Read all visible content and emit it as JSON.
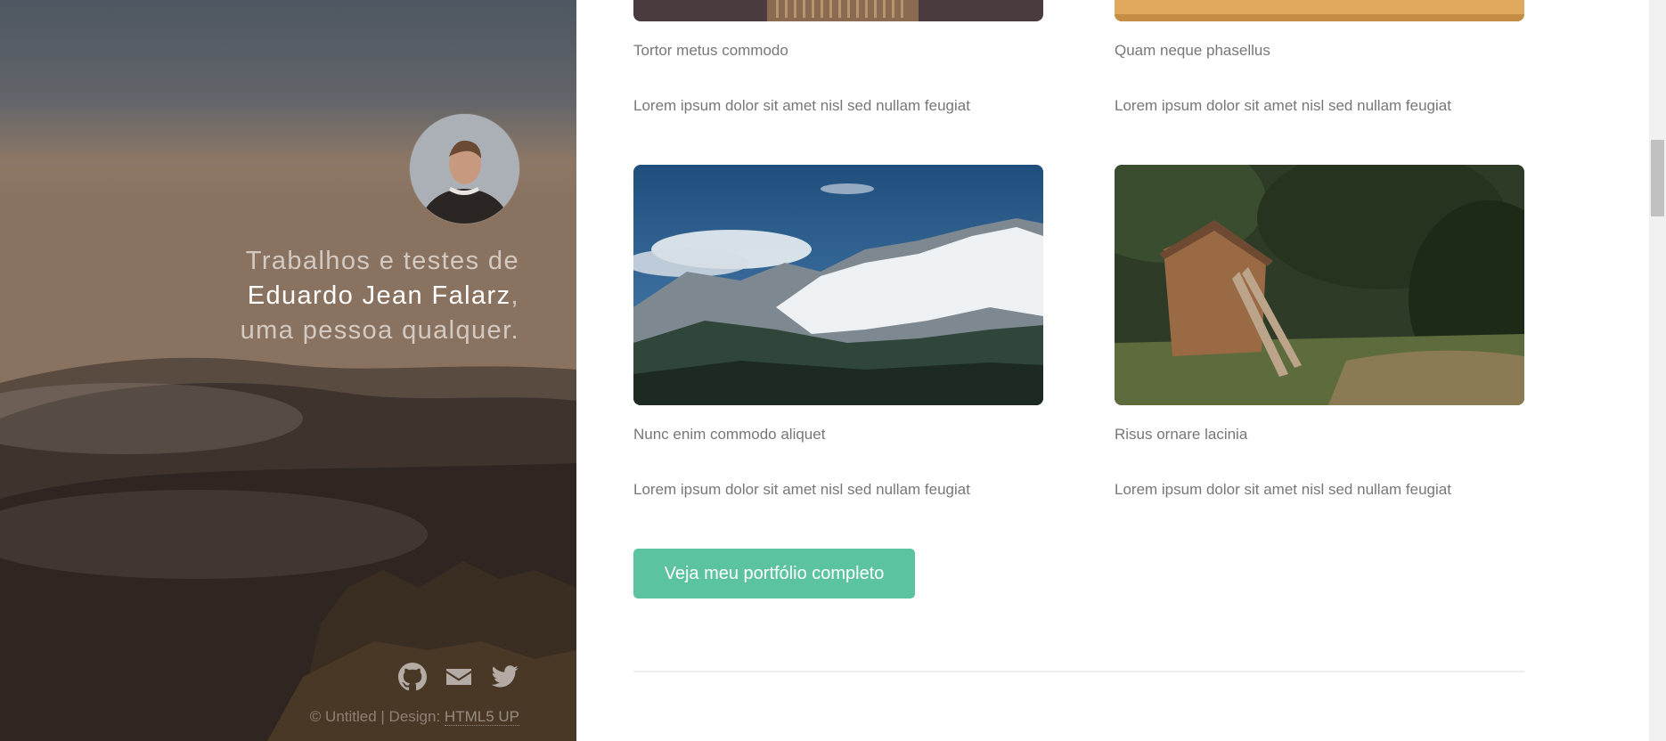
{
  "sidebar": {
    "intro_line1": "Trabalhos e testes de",
    "intro_name": "Eduardo Jean Falarz",
    "intro_comma": ",",
    "intro_line3": "uma pessoa qualquer.",
    "social": [
      {
        "icon": "github-icon"
      },
      {
        "icon": "envelope-icon"
      },
      {
        "icon": "twitter-icon"
      }
    ],
    "footer_text": "© Untitled | Design: ",
    "footer_link": "HTML5 UP"
  },
  "portfolio": {
    "items": [
      {
        "title": "Tortor metus commodo",
        "description": "Lorem ipsum dolor sit amet nisl sed nullam feugiat"
      },
      {
        "title": "Quam neque phasellus",
        "description": "Lorem ipsum dolor sit amet nisl sed nullam feugiat"
      },
      {
        "title": "Nunc enim commodo aliquet",
        "description": "Lorem ipsum dolor sit amet nisl sed nullam feugiat"
      },
      {
        "title": "Risus ornare lacinia",
        "description": "Lorem ipsum dolor sit amet nisl sed nullam feugiat"
      }
    ],
    "cta_label": "Veja meu portfólio completo"
  },
  "colors": {
    "accent": "#5cc3a0",
    "text": "#777777",
    "divider": "#eeeeee"
  }
}
